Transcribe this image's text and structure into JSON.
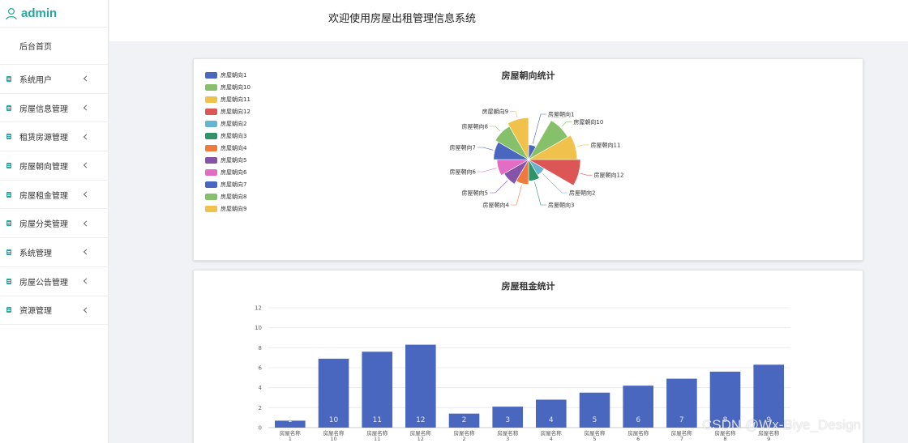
{
  "sidebar": {
    "brand": "admin",
    "home": "后台首页",
    "items": [
      {
        "label": "系统用户"
      },
      {
        "label": "房屋信息管理"
      },
      {
        "label": "租赁房源管理"
      },
      {
        "label": "房屋朝向管理"
      },
      {
        "label": "房屋租金管理"
      },
      {
        "label": "房屋分类管理"
      },
      {
        "label": "系统管理"
      },
      {
        "label": "房屋公告管理"
      },
      {
        "label": "资源管理"
      }
    ]
  },
  "header": {
    "title": "欢迎使用房屋出租管理信息系统"
  },
  "watermark": "CSDN @Wx-Biye_Design",
  "palette": [
    "#4a67bf",
    "#86c06a",
    "#f1c24b",
    "#dd5656",
    "#66b4cf",
    "#2f9367",
    "#ef7a3e",
    "#8753a9",
    "#e36cc5"
  ],
  "chart_data": [
    {
      "type": "pie",
      "title": "房屋朝向统计",
      "legend_position": "top-left",
      "rose_type": "radius",
      "categories": [
        "房屋朝向1",
        "房屋朝向10",
        "房屋朝向11",
        "房屋朝向12",
        "房屋朝向2",
        "房屋朝向3",
        "房屋朝向4",
        "房屋朝向5",
        "房屋朝向6",
        "房屋朝向7",
        "房屋朝向8",
        "房屋朝向9"
      ],
      "values": [
        1,
        10,
        11,
        12,
        2,
        3,
        4,
        5,
        6,
        7,
        8,
        9
      ]
    },
    {
      "type": "bar",
      "title": "房屋租金统计",
      "categories": [
        [
          "房屋名称",
          "1"
        ],
        [
          "房屋名称",
          "10"
        ],
        [
          "房屋名称",
          "11"
        ],
        [
          "房屋名称",
          "12"
        ],
        [
          "房屋名称",
          "2"
        ],
        [
          "房屋名称",
          "3"
        ],
        [
          "房屋名称",
          "4"
        ],
        [
          "房屋名称",
          "5"
        ],
        [
          "房屋名称",
          "6"
        ],
        [
          "房屋名称",
          "7"
        ],
        [
          "房屋名称",
          "8"
        ],
        [
          "房屋名称",
          "9"
        ]
      ],
      "values": [
        0.7,
        6.9,
        7.6,
        8.3,
        1.4,
        2.1,
        2.8,
        3.5,
        4.2,
        4.9,
        5.6,
        6.3
      ],
      "data_labels": [
        "1",
        "10",
        "11",
        "12",
        "2",
        "3",
        "4",
        "5",
        "6",
        "7",
        "8",
        "9"
      ],
      "ylim": [
        0,
        12
      ],
      "yticks": [
        0,
        2,
        4,
        6,
        8,
        10,
        12
      ],
      "grid": true,
      "bar_color": "#4a67bf"
    }
  ]
}
